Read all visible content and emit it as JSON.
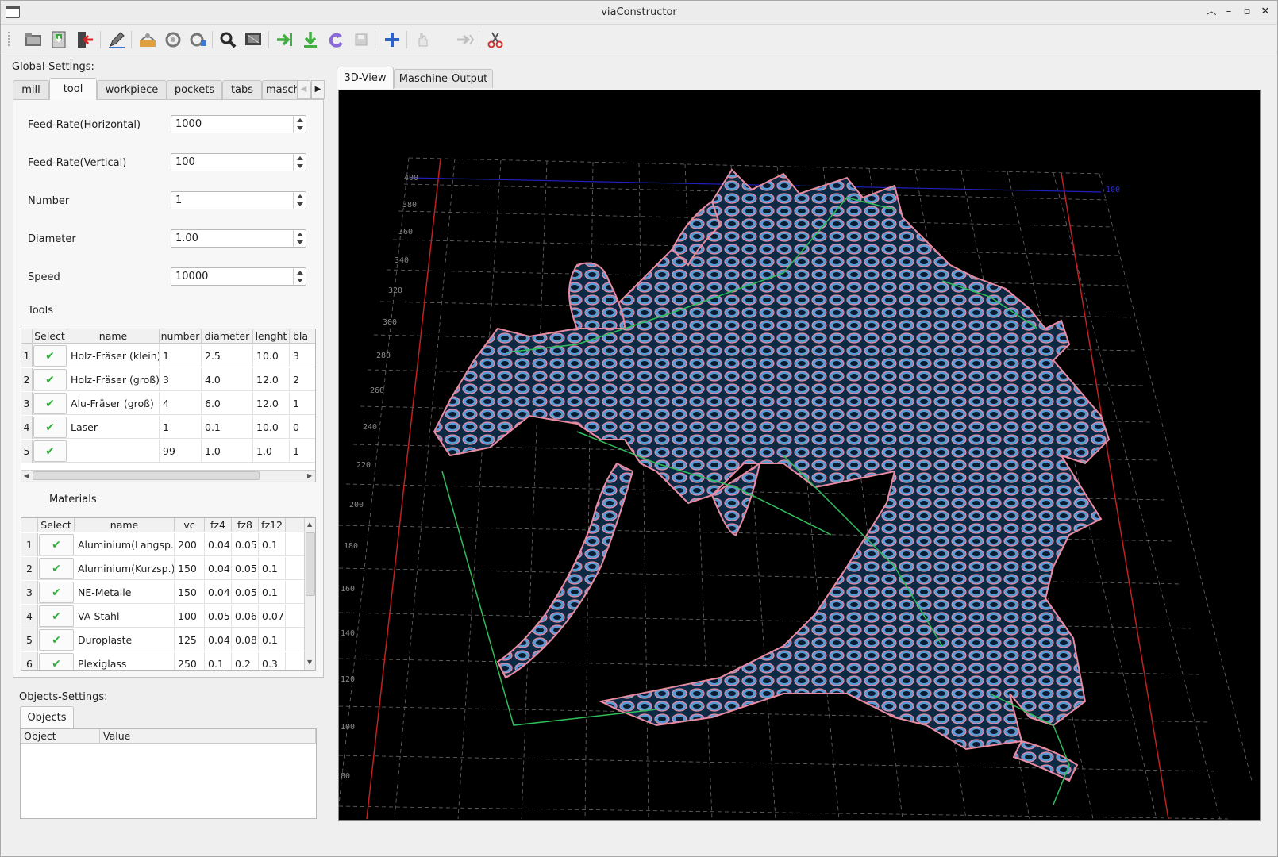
{
  "app": {
    "title": "viaConstructor"
  },
  "toolbar": {
    "icons": [
      "open-file-icon",
      "save-file-icon",
      "exit-icon",
      "edit-icon",
      "mill-paths-icon",
      "mill-paths-2-icon",
      "mill-paths-3-icon",
      "search-icon",
      "screen-icon",
      "arrow-right-icon",
      "download-icon",
      "reload-icon",
      "disk-icon",
      "add-icon",
      "hand-icon",
      "forward-icon",
      "cut-icon"
    ]
  },
  "global_settings": {
    "label": "Global-Settings:",
    "tabs": [
      "mill",
      "tool",
      "workpiece",
      "pockets",
      "tabs",
      "maschin"
    ],
    "active_tab": "tool",
    "fields": [
      {
        "label": "Feed-Rate(Horizontal)",
        "value": "1000"
      },
      {
        "label": "Feed-Rate(Vertical)",
        "value": "100"
      },
      {
        "label": "Number",
        "value": "1"
      },
      {
        "label": "Diameter",
        "value": "1.00"
      },
      {
        "label": "Speed",
        "value": "10000"
      }
    ]
  },
  "tools": {
    "label": "Tools",
    "columns": [
      "Select",
      "name",
      "number",
      "diameter",
      "lenght",
      "bla"
    ],
    "rows": [
      {
        "num": "1",
        "name": "Holz-Fräser (klein)",
        "number": "1",
        "diameter": "2.5",
        "lenght": "10.0",
        "bla": "3"
      },
      {
        "num": "2",
        "name": "Holz-Fräser (groß)",
        "number": "3",
        "diameter": "4.0",
        "lenght": "12.0",
        "bla": "2"
      },
      {
        "num": "3",
        "name": "Alu-Fräser (groß)",
        "number": "4",
        "diameter": "6.0",
        "lenght": "12.0",
        "bla": "1"
      },
      {
        "num": "4",
        "name": "Laser",
        "number": "1",
        "diameter": "0.1",
        "lenght": "10.0",
        "bla": "0"
      },
      {
        "num": "5",
        "name": "",
        "number": "99",
        "diameter": "1.0",
        "lenght": "1.0",
        "bla": "1"
      }
    ]
  },
  "materials": {
    "label": "Materials",
    "columns": [
      "Select",
      "name",
      "vc",
      "fz4",
      "fz8",
      "fz12"
    ],
    "rows": [
      {
        "num": "1",
        "name": "Aluminium(Langsp.)",
        "vc": "200",
        "fz4": "0.04",
        "fz8": "0.05",
        "fz12": "0.1"
      },
      {
        "num": "2",
        "name": "Aluminium(Kurzsp.)",
        "vc": "150",
        "fz4": "0.04",
        "fz8": "0.05",
        "fz12": "0.1"
      },
      {
        "num": "3",
        "name": "NE-Metalle",
        "vc": "150",
        "fz4": "0.04",
        "fz8": "0.05",
        "fz12": "0.1"
      },
      {
        "num": "4",
        "name": "VA-Stahl",
        "vc": "100",
        "fz4": "0.05",
        "fz8": "0.06",
        "fz12": "0.07"
      },
      {
        "num": "5",
        "name": "Duroplaste",
        "vc": "125",
        "fz4": "0.04",
        "fz8": "0.08",
        "fz12": "0.1"
      },
      {
        "num": "6",
        "name": "Plexiglass",
        "vc": "250",
        "fz4": "0.1",
        "fz8": "0.2",
        "fz12": "0.3"
      }
    ]
  },
  "objects_settings": {
    "label": "Objects-Settings:",
    "tab": "Objects",
    "columns": [
      "Object",
      "Value"
    ]
  },
  "view": {
    "tabs": [
      "3D-View",
      "Maschine-Output"
    ],
    "active_tab": "3D-View"
  },
  "colors": {
    "accent_check": "#2fae3b",
    "view_background": "#000000",
    "outline": "#e88aa0",
    "fill": "#5aa0d8",
    "toolpath": "#2fbf5a"
  }
}
